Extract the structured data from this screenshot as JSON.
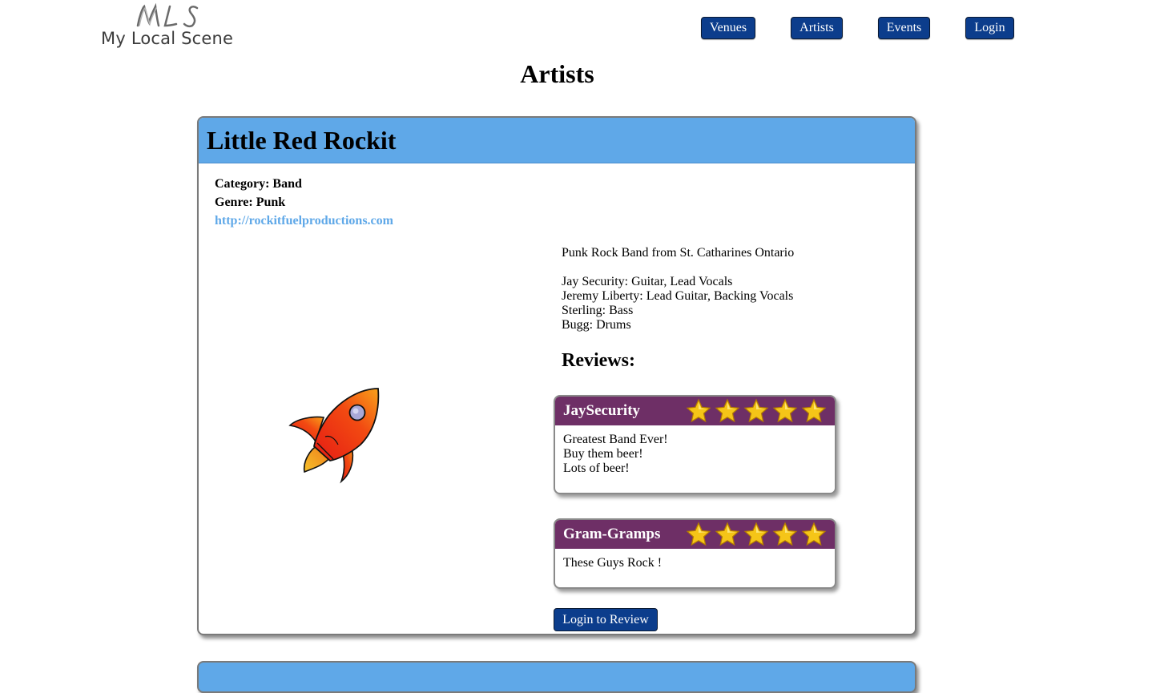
{
  "logo": {
    "mark_text": "MLS",
    "name": "My Local Scene"
  },
  "nav": {
    "venues": "Venues",
    "artists": "Artists",
    "events": "Events",
    "login": "Login"
  },
  "page": {
    "title": "Artists"
  },
  "artist": {
    "name": "Little Red Rockit",
    "category": "Category: Band",
    "genre": "Genre: Punk",
    "website": "http://rockitfuelproductions.com",
    "image_icon": "rocket-icon",
    "bio": "Punk Rock Band from St. Catharines Ontario\n\nJay Security: Guitar, Lead Vocals\nJeremy Liberty: Lead Guitar, Backing Vocals\nSterling: Bass\nBugg: Drums",
    "reviews_title": "Reviews:",
    "reviews": [
      {
        "author": "JaySecurity",
        "rating": 5,
        "text": "Greatest Band Ever!\nBuy them beer!\nLots of beer!"
      },
      {
        "author": "Gram-Gramps",
        "rating": 5,
        "text": "These Guys Rock !"
      }
    ],
    "review_button": "Login to Review"
  },
  "colors": {
    "card_header": "#5fa8e8",
    "review_header": "#6e2f66",
    "button": "#0c3d8c",
    "link": "#5fa8e8",
    "star": "#f5c518"
  }
}
